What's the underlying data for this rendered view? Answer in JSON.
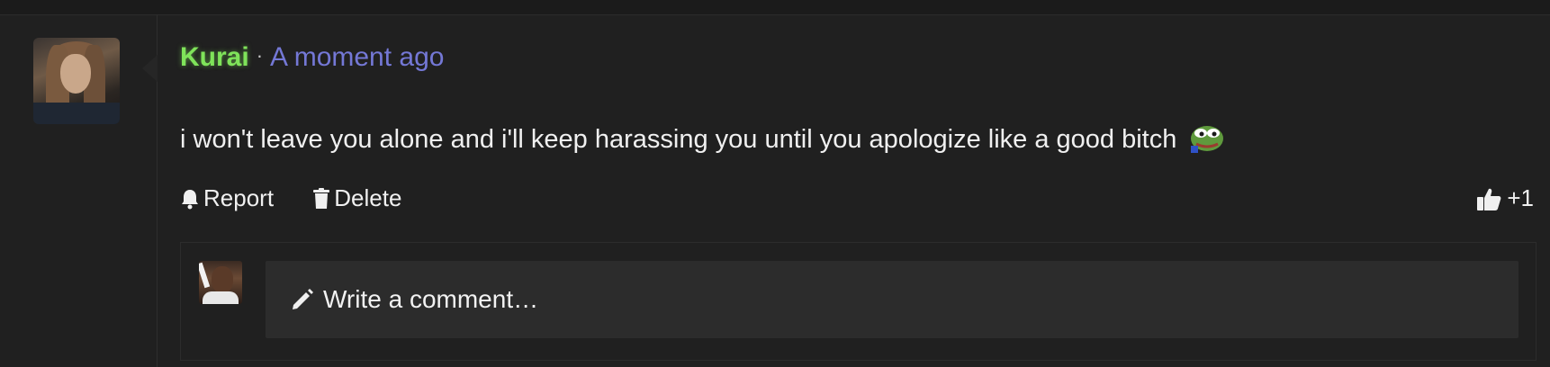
{
  "comment": {
    "username": "Kurai",
    "separator": "·",
    "timestamp": "A moment ago",
    "text": "i won't leave you alone and i'll keep harassing you until you apologize like a good bitch",
    "emote_icon": "pepe-frog-emote"
  },
  "actions": {
    "report_label": "Report",
    "delete_label": "Delete",
    "like_count": "+1"
  },
  "reply": {
    "placeholder": "Write a comment…"
  },
  "colors": {
    "username": "#7fe35a",
    "timestamp": "#7478d6",
    "background": "#202020",
    "input_background": "#2c2c2c"
  }
}
